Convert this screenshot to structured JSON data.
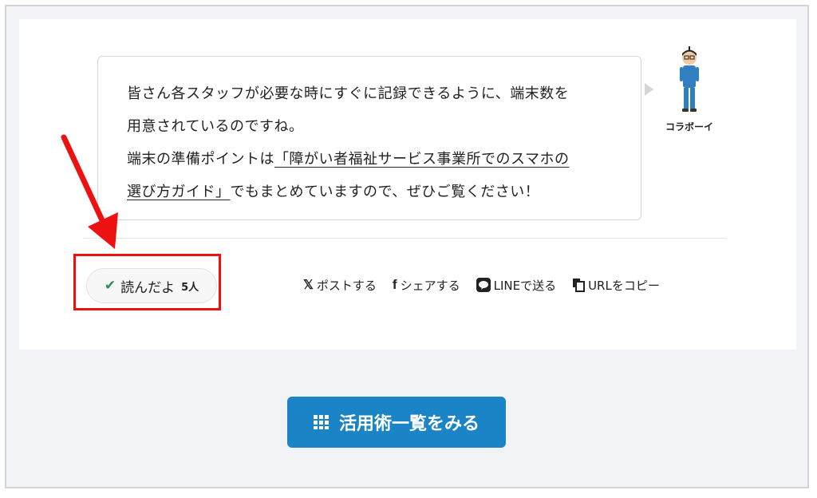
{
  "bubble": {
    "lines": [
      "皆さん各スタッフが必要な時にすぐに記録できるように、端末数を",
      "用意されているのですね。",
      "端末の準備ポイントは",
      "「障がい者福祉サービス事業所でのスマホの",
      "選び方ガイド」",
      "でもまとめていますので、ぜひご覧ください！"
    ]
  },
  "speaker": {
    "name": "コラボーイ",
    "icon": "boy-avatar-icon"
  },
  "reaction": {
    "label": "読んだよ",
    "count": "5人",
    "icon": "check-icon",
    "color": "#2e8b57"
  },
  "share": {
    "x": {
      "icon": "𝕏",
      "label": "ポストする"
    },
    "facebook": {
      "icon": "f",
      "label": "シェアする"
    },
    "line": {
      "label": "LINEで送る"
    },
    "copy": {
      "label": "URLをコピー"
    }
  },
  "cta": {
    "label": "活用術一覧をみる",
    "icon": "grid-icon",
    "color": "#1a84c6"
  },
  "annotation": {
    "color": "#ee1111"
  }
}
